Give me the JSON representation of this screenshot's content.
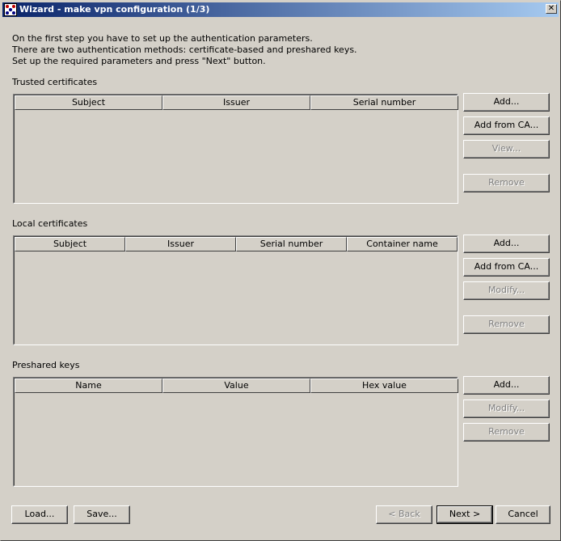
{
  "window": {
    "title": "Wizard - make vpn configuration (1/3)",
    "close_label": "✕"
  },
  "intro": {
    "line1": "On the first step you have to set up the authentication parameters.",
    "line2": "There are two authentication methods: certificate-based and preshared keys.",
    "line3": "Set up the required parameters and press \"Next\" button."
  },
  "trusted": {
    "label": "Trusted certificates",
    "columns": [
      "Subject",
      "Issuer",
      "Serial number"
    ],
    "buttons": {
      "add": "Add...",
      "add_from_ca": "Add from CA...",
      "view": "View...",
      "remove": "Remove"
    }
  },
  "local": {
    "label": "Local certificates",
    "columns": [
      "Subject",
      "Issuer",
      "Serial number",
      "Container name"
    ],
    "buttons": {
      "add": "Add...",
      "add_from_ca": "Add from CA...",
      "modify": "Modify...",
      "remove": "Remove"
    }
  },
  "preshared": {
    "label": "Preshared keys",
    "columns": [
      "Name",
      "Value",
      "Hex value"
    ],
    "buttons": {
      "add": "Add...",
      "modify": "Modify...",
      "remove": "Remove"
    }
  },
  "footer": {
    "load": "Load...",
    "save": "Save...",
    "back": "< Back",
    "next": "Next >",
    "cancel": "Cancel"
  },
  "colors": {
    "titlebar_start": "#0a246a",
    "titlebar_end": "#a6caf0",
    "face": "#d4d0c8"
  }
}
